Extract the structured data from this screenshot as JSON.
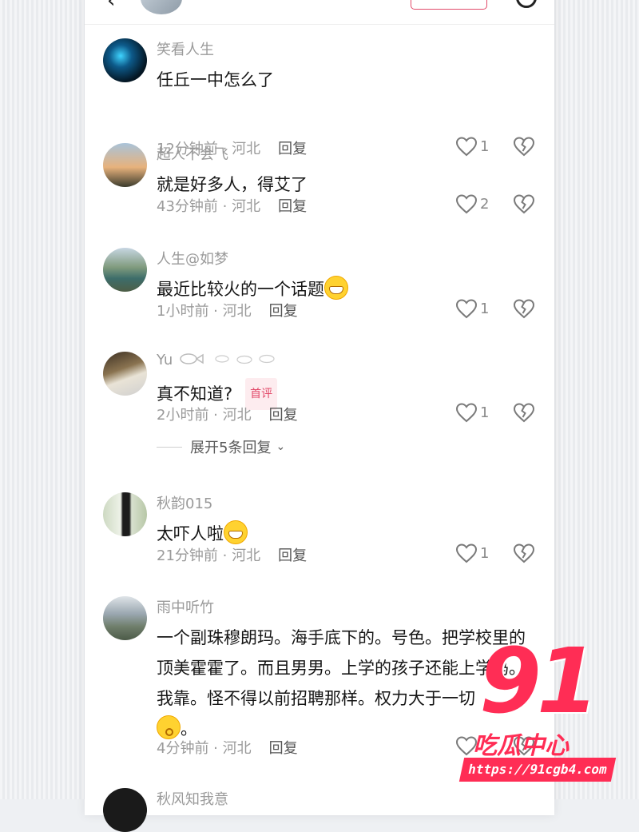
{
  "header": {
    "back_icon": "chevron-left-icon",
    "search_icon": "search-icon"
  },
  "comments": [
    {
      "username": "笑看人生",
      "text": "任丘一中怎么了",
      "time": "12分钟前",
      "location": "河北",
      "reply": "回复",
      "likes": "1"
    },
    {
      "username": "超人不会飞",
      "text": "就是好多人，得艾了",
      "time": "43分钟前",
      "location": "河北",
      "reply": "回复",
      "likes": "2"
    },
    {
      "username": "人生@如梦",
      "text": "最近比较火的一个话题",
      "emoji": "grinning-face",
      "time": "1小时前",
      "location": "河北",
      "reply": "回复",
      "likes": "1"
    },
    {
      "username": "Yu",
      "text": "真不知道?",
      "badge": "首评",
      "time": "2小时前",
      "location": "河北",
      "reply": "回复",
      "likes": "1",
      "expand": "展开5条回复"
    },
    {
      "username": "秋韵015",
      "text": "太吓人啦",
      "emoji": "grinning-face",
      "time": "21分钟前",
      "location": "河北",
      "reply": "回复",
      "likes": "1"
    },
    {
      "username": "雨中听竹",
      "text": "一个副珠穆朗玛。海手底下的。号色。把学校里的顶美霍霍了。而且男男。上学的孩子还能上学吗。我靠。怪不得以前招聘那样。权力大于一切",
      "emoji": "kissing-face",
      "text_tail": "。",
      "time": "4分钟前",
      "location": "河北",
      "reply": "回复",
      "likes": ""
    },
    {
      "username": "秋风知我意",
      "text": "",
      "time": "",
      "location": "",
      "reply": "",
      "likes": ""
    }
  ],
  "watermark": {
    "number": "91",
    "name": "吃瓜中心",
    "url": "https://91cgb4.com"
  },
  "colors": {
    "accent": "#e24a6a",
    "watermark": "#ff2d55"
  }
}
